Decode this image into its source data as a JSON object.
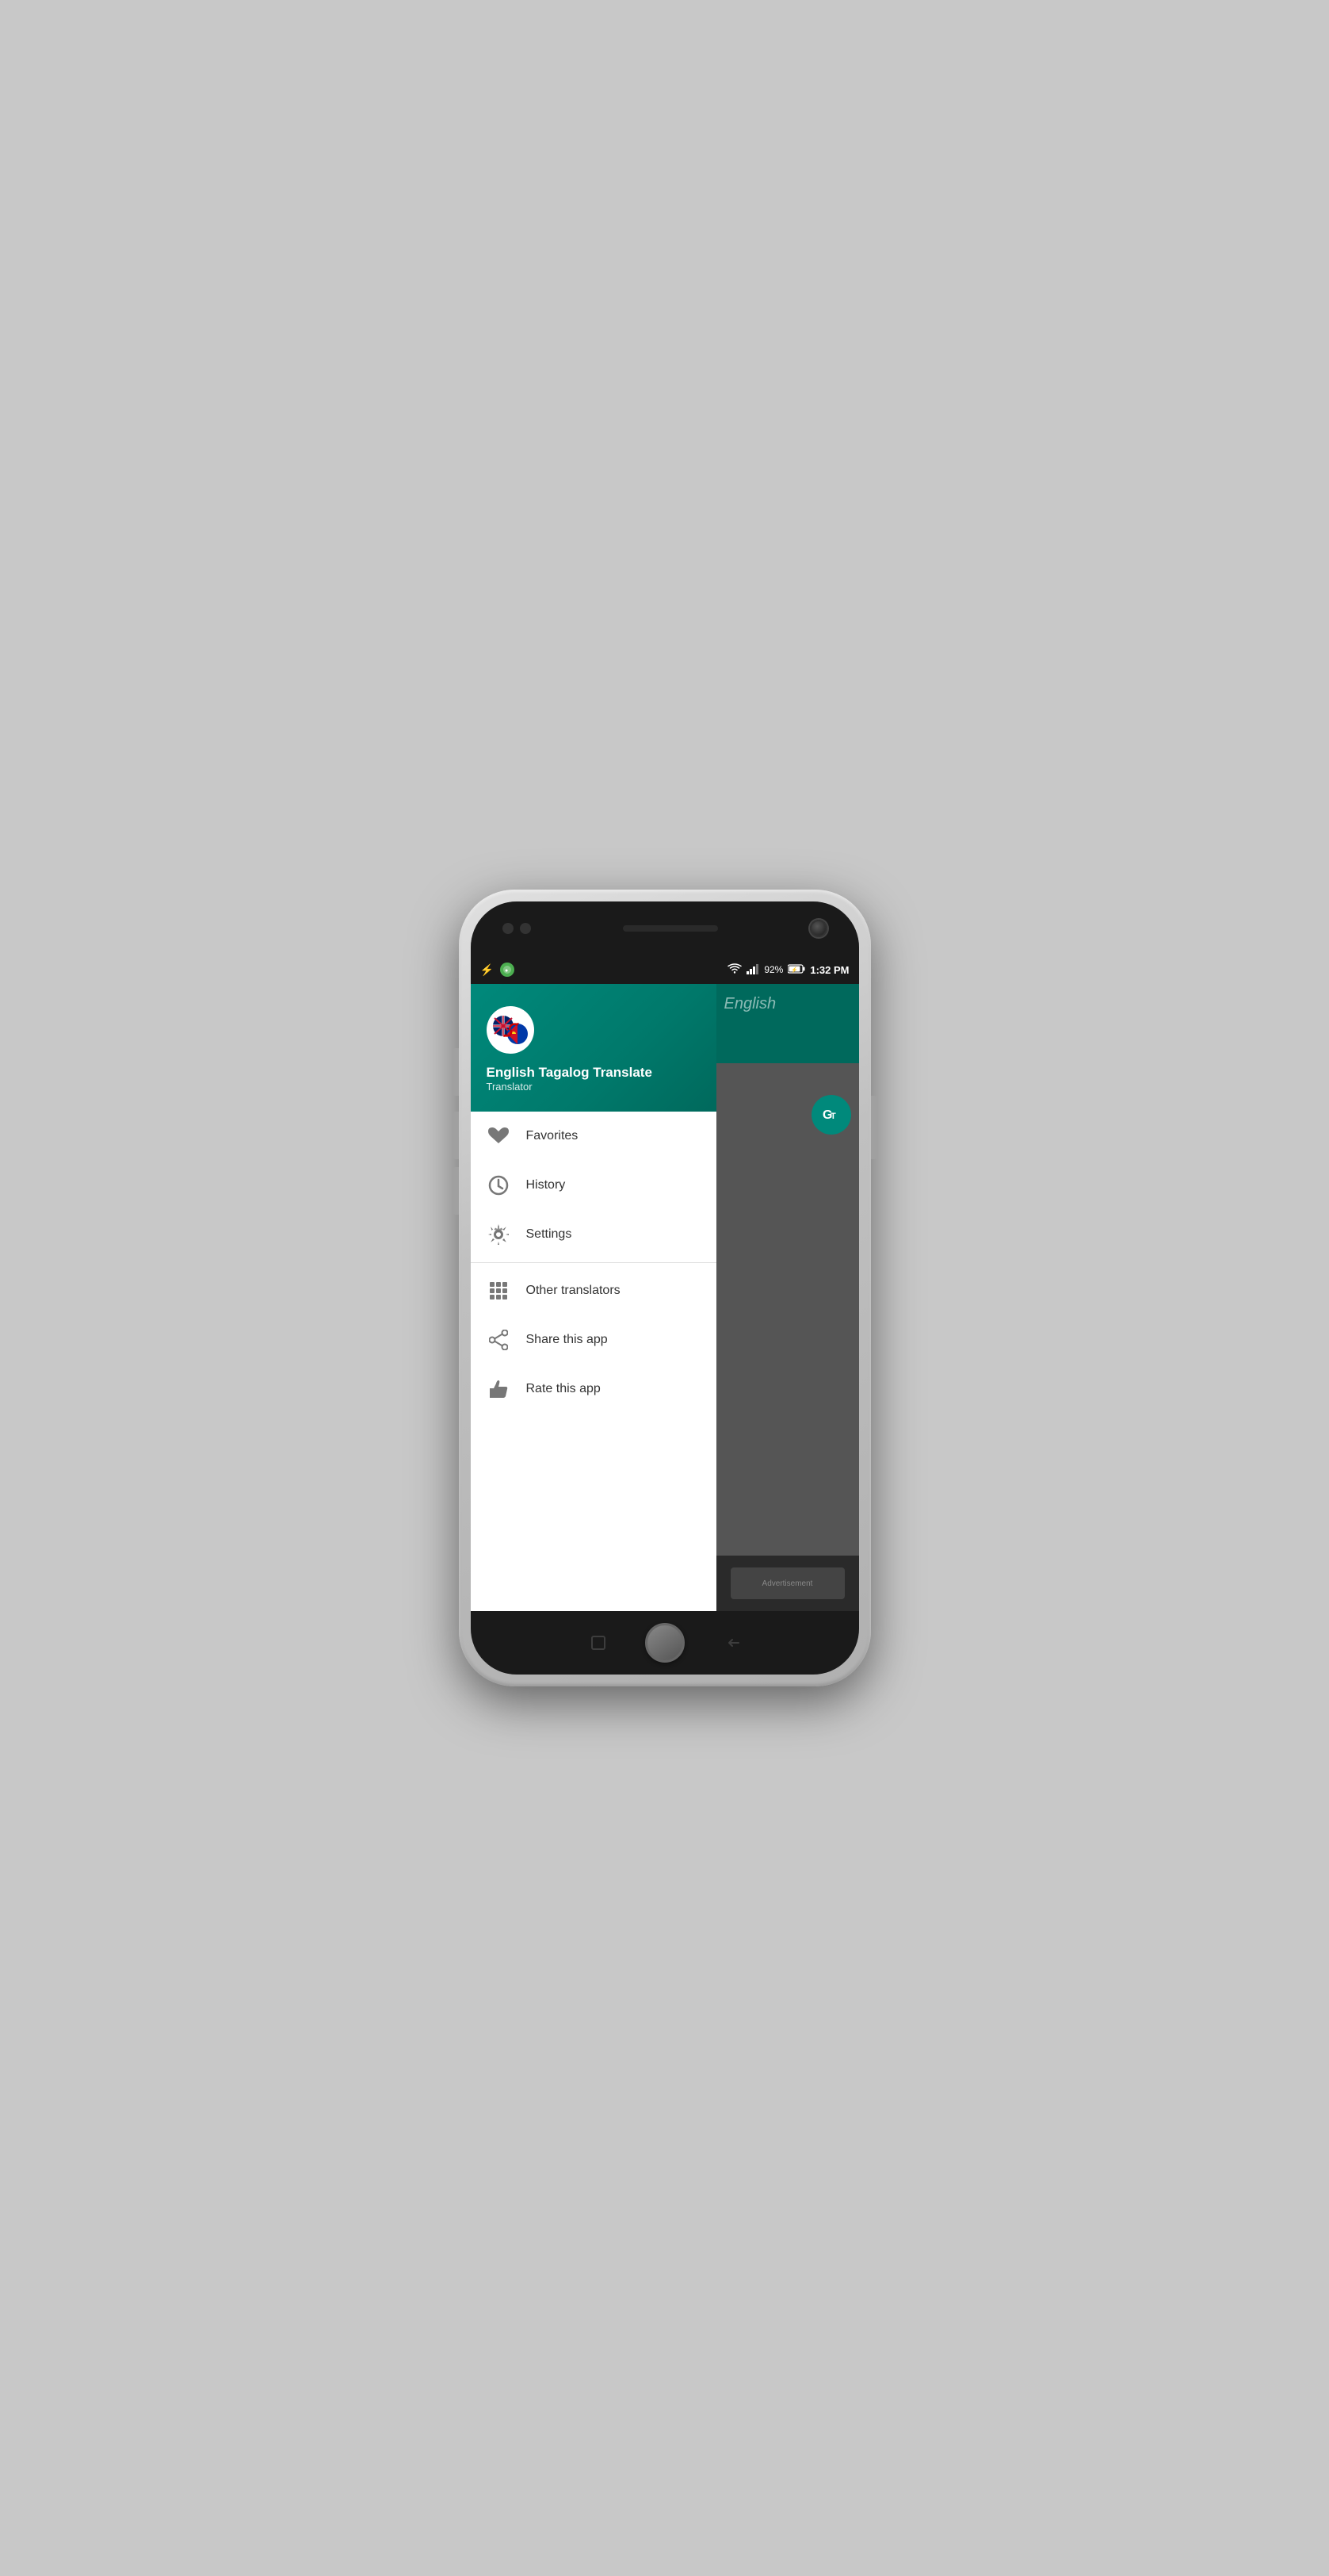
{
  "statusBar": {
    "time": "1:32 PM",
    "battery": "92%",
    "batteryIcon": "⚡",
    "wifiIcon": "wifi",
    "signalIcon": "signal"
  },
  "app": {
    "title": "English Tagalog Translate",
    "subtitle": "Translator",
    "bgLanguage": "English"
  },
  "menu": {
    "items": [
      {
        "id": "favorites",
        "label": "Favorites",
        "icon": "heart"
      },
      {
        "id": "history",
        "label": "History",
        "icon": "clock"
      },
      {
        "id": "settings",
        "label": "Settings",
        "icon": "gear"
      }
    ],
    "secondaryItems": [
      {
        "id": "other-translators",
        "label": "Other translators",
        "icon": "grid"
      },
      {
        "id": "share",
        "label": "Share this app",
        "icon": "share"
      },
      {
        "id": "rate",
        "label": "Rate this app",
        "icon": "thumbsup"
      }
    ]
  }
}
